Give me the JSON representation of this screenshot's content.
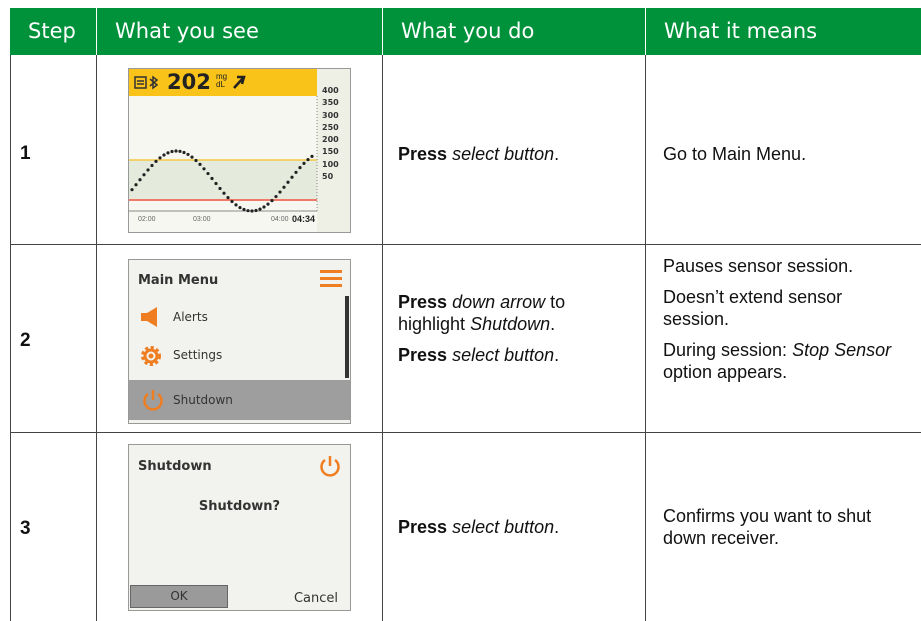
{
  "headers": [
    "Step",
    "What you see",
    "What you do",
    "What it means"
  ],
  "rows": [
    {
      "step": "1",
      "screen": {
        "bg_value": "202",
        "unit_top": "mg",
        "unit_bottom": "dL",
        "y_ticks": [
          "400",
          "350",
          "300",
          "250",
          "200",
          "150",
          "100",
          "50"
        ],
        "x_ticks": [
          "02:00",
          "03:00",
          "04:00"
        ],
        "time": "04:34"
      },
      "do": {
        "bold": "Press",
        "italic": "select button",
        "tail": "."
      },
      "means": [
        "Go to Main Menu."
      ]
    },
    {
      "step": "2",
      "screen": {
        "title": "Main Menu",
        "items": [
          "Alerts",
          "Settings",
          "Shutdown"
        ]
      },
      "do": {
        "line1_bold": "Press",
        "line1_italic": "down arrow",
        "line1_tail": " to",
        "line2_pre": "highlight ",
        "line2_italic": "Shutdown",
        "line2_tail": ".",
        "line3_bold": "Press",
        "line3_italic": "select button",
        "line3_tail": "."
      },
      "means": {
        "p1": "Pauses sensor session.",
        "p2": "Doesn’t extend sensor session.",
        "p3_pre": "During session: ",
        "p3_italic": "Stop Sensor",
        "p3_tail": " option appears."
      }
    },
    {
      "step": "3",
      "screen": {
        "title": "Shutdown",
        "question": "Shutdown?",
        "ok": "OK",
        "cancel": "Cancel"
      },
      "do": {
        "bold": "Press",
        "italic": "select button",
        "tail": "."
      },
      "means": [
        "Confirms you want to shut down receiver."
      ]
    }
  ],
  "colors": {
    "header_bg": "#00923b",
    "status_yellow": "#f9c31a",
    "accent_orange": "#ef7d22",
    "target_yellow": "#f5c842",
    "low_red": "#f07a6a"
  }
}
